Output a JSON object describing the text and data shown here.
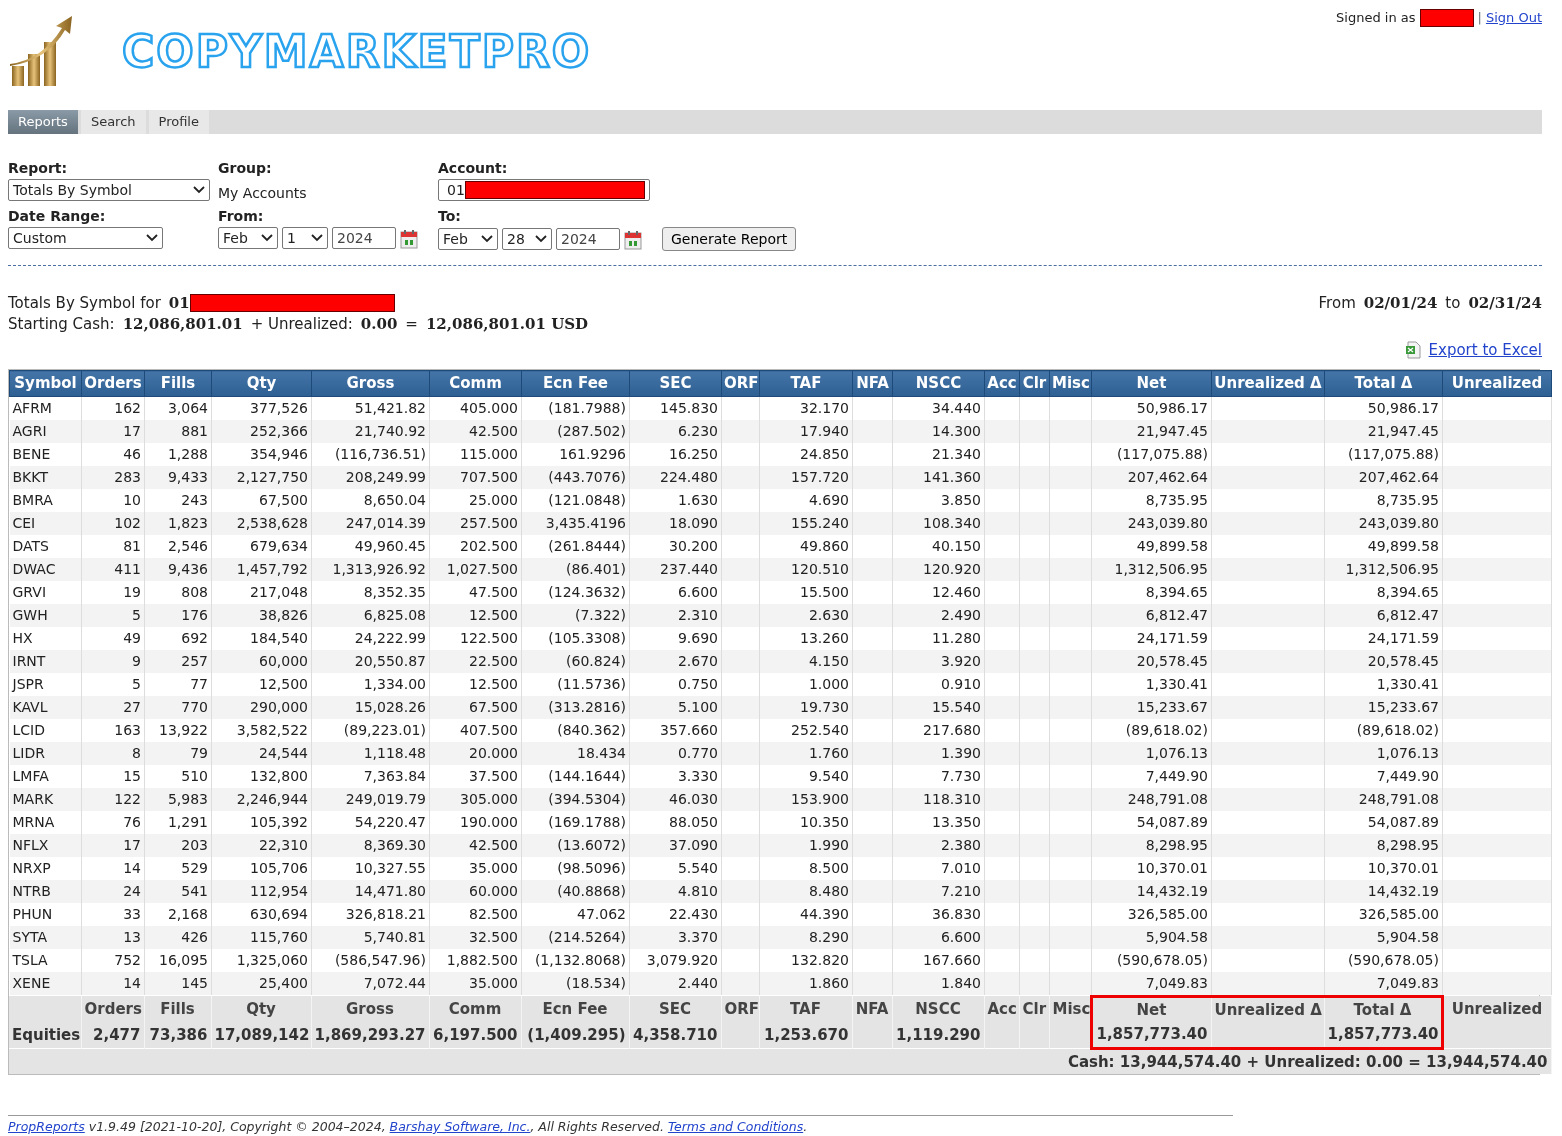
{
  "header": {
    "logo_text": "COPYMARKETPRO",
    "signed_in_label": "Signed in as",
    "user_redacted": true,
    "separator": "|",
    "sign_out": "Sign Out"
  },
  "tabs": [
    {
      "label": "Reports",
      "selected": true
    },
    {
      "label": "Search",
      "selected": false
    },
    {
      "label": "Profile",
      "selected": false
    }
  ],
  "form": {
    "report_label": "Report:",
    "report_value": "Totals By Symbol",
    "group_label": "Group:",
    "group_value": "My Accounts",
    "account_label": "Account:",
    "account_value": "01",
    "account_redacted": true,
    "date_range_label": "Date Range:",
    "date_range_value": "Custom",
    "from_label": "From:",
    "from_month": "Feb",
    "from_day": "1",
    "from_year": "2024",
    "to_label": "To:",
    "to_month": "Feb",
    "to_day": "28",
    "to_year": "2024",
    "generate_button": "Generate Report"
  },
  "summary": {
    "title": "Totals By Symbol for",
    "account": "01",
    "account_redacted": true,
    "starting_cash_label": "Starting Cash:",
    "starting_cash": "12,086,801.01",
    "plus_unrealized_label": "+ Unrealized:",
    "unrealized": "0.00",
    "equals": "=",
    "total": "12,086,801.01 USD",
    "from_label": "From",
    "from_date": "02/01/24",
    "to_label": "to",
    "to_date": "02/31/24",
    "export_link": "Export to Excel"
  },
  "table": {
    "columns": [
      "Symbol",
      "Orders",
      "Fills",
      "Qty",
      "Gross",
      "Comm",
      "Ecn Fee",
      "SEC",
      "ORF",
      "TAF",
      "NFA",
      "NSCC",
      "Acc",
      "Clr",
      "Misc",
      "Net",
      "Unrealized Δ",
      "Total Δ",
      "Unrealized"
    ],
    "rows": [
      [
        "AFRM",
        "162",
        "3,064",
        "377,526",
        "51,421.82",
        "405.000",
        "(181.7988)",
        "145.830",
        "",
        "32.170",
        "",
        "34.440",
        "",
        "",
        "",
        "50,986.17",
        "",
        "50,986.17",
        ""
      ],
      [
        "AGRI",
        "17",
        "881",
        "252,366",
        "21,740.92",
        "42.500",
        "(287.502)",
        "6.230",
        "",
        "17.940",
        "",
        "14.300",
        "",
        "",
        "",
        "21,947.45",
        "",
        "21,947.45",
        ""
      ],
      [
        "BENE",
        "46",
        "1,288",
        "354,946",
        "(116,736.51)",
        "115.000",
        "161.9296",
        "16.250",
        "",
        "24.850",
        "",
        "21.340",
        "",
        "",
        "",
        "(117,075.88)",
        "",
        "(117,075.88)",
        ""
      ],
      [
        "BKKT",
        "283",
        "9,433",
        "2,127,750",
        "208,249.99",
        "707.500",
        "(443.7076)",
        "224.480",
        "",
        "157.720",
        "",
        "141.360",
        "",
        "",
        "",
        "207,462.64",
        "",
        "207,462.64",
        ""
      ],
      [
        "BMRA",
        "10",
        "243",
        "67,500",
        "8,650.04",
        "25.000",
        "(121.0848)",
        "1.630",
        "",
        "4.690",
        "",
        "3.850",
        "",
        "",
        "",
        "8,735.95",
        "",
        "8,735.95",
        ""
      ],
      [
        "CEI",
        "102",
        "1,823",
        "2,538,628",
        "247,014.39",
        "257.500",
        "3,435.4196",
        "18.090",
        "",
        "155.240",
        "",
        "108.340",
        "",
        "",
        "",
        "243,039.80",
        "",
        "243,039.80",
        ""
      ],
      [
        "DATS",
        "81",
        "2,546",
        "679,634",
        "49,960.45",
        "202.500",
        "(261.8444)",
        "30.200",
        "",
        "49.860",
        "",
        "40.150",
        "",
        "",
        "",
        "49,899.58",
        "",
        "49,899.58",
        ""
      ],
      [
        "DWAC",
        "411",
        "9,436",
        "1,457,792",
        "1,313,926.92",
        "1,027.500",
        "(86.401)",
        "237.440",
        "",
        "120.510",
        "",
        "120.920",
        "",
        "",
        "",
        "1,312,506.95",
        "",
        "1,312,506.95",
        ""
      ],
      [
        "GRVI",
        "19",
        "808",
        "217,048",
        "8,352.35",
        "47.500",
        "(124.3632)",
        "6.600",
        "",
        "15.500",
        "",
        "12.460",
        "",
        "",
        "",
        "8,394.65",
        "",
        "8,394.65",
        ""
      ],
      [
        "GWH",
        "5",
        "176",
        "38,826",
        "6,825.08",
        "12.500",
        "(7.322)",
        "2.310",
        "",
        "2.630",
        "",
        "2.490",
        "",
        "",
        "",
        "6,812.47",
        "",
        "6,812.47",
        ""
      ],
      [
        "HX",
        "49",
        "692",
        "184,540",
        "24,222.99",
        "122.500",
        "(105.3308)",
        "9.690",
        "",
        "13.260",
        "",
        "11.280",
        "",
        "",
        "",
        "24,171.59",
        "",
        "24,171.59",
        ""
      ],
      [
        "IRNT",
        "9",
        "257",
        "60,000",
        "20,550.87",
        "22.500",
        "(60.824)",
        "2.670",
        "",
        "4.150",
        "",
        "3.920",
        "",
        "",
        "",
        "20,578.45",
        "",
        "20,578.45",
        ""
      ],
      [
        "JSPR",
        "5",
        "77",
        "12,500",
        "1,334.00",
        "12.500",
        "(11.5736)",
        "0.750",
        "",
        "1.000",
        "",
        "0.910",
        "",
        "",
        "",
        "1,330.41",
        "",
        "1,330.41",
        ""
      ],
      [
        "KAVL",
        "27",
        "770",
        "290,000",
        "15,028.26",
        "67.500",
        "(313.2816)",
        "5.100",
        "",
        "19.730",
        "",
        "15.540",
        "",
        "",
        "",
        "15,233.67",
        "",
        "15,233.67",
        ""
      ],
      [
        "LCID",
        "163",
        "13,922",
        "3,582,522",
        "(89,223.01)",
        "407.500",
        "(840.362)",
        "357.660",
        "",
        "252.540",
        "",
        "217.680",
        "",
        "",
        "",
        "(89,618.02)",
        "",
        "(89,618.02)",
        ""
      ],
      [
        "LIDR",
        "8",
        "79",
        "24,544",
        "1,118.48",
        "20.000",
        "18.434",
        "0.770",
        "",
        "1.760",
        "",
        "1.390",
        "",
        "",
        "",
        "1,076.13",
        "",
        "1,076.13",
        ""
      ],
      [
        "LMFA",
        "15",
        "510",
        "132,800",
        "7,363.84",
        "37.500",
        "(144.1644)",
        "3.330",
        "",
        "9.540",
        "",
        "7.730",
        "",
        "",
        "",
        "7,449.90",
        "",
        "7,449.90",
        ""
      ],
      [
        "MARK",
        "122",
        "5,983",
        "2,246,944",
        "249,019.79",
        "305.000",
        "(394.5304)",
        "46.030",
        "",
        "153.900",
        "",
        "118.310",
        "",
        "",
        "",
        "248,791.08",
        "",
        "248,791.08",
        ""
      ],
      [
        "MRNA",
        "76",
        "1,291",
        "105,392",
        "54,220.47",
        "190.000",
        "(169.1788)",
        "88.050",
        "",
        "10.350",
        "",
        "13.350",
        "",
        "",
        "",
        "54,087.89",
        "",
        "54,087.89",
        ""
      ],
      [
        "NFLX",
        "17",
        "203",
        "22,310",
        "8,369.30",
        "42.500",
        "(13.6072)",
        "37.090",
        "",
        "1.990",
        "",
        "2.380",
        "",
        "",
        "",
        "8,298.95",
        "",
        "8,298.95",
        ""
      ],
      [
        "NRXP",
        "14",
        "529",
        "105,706",
        "10,327.55",
        "35.000",
        "(98.5096)",
        "5.540",
        "",
        "8.500",
        "",
        "7.010",
        "",
        "",
        "",
        "10,370.01",
        "",
        "10,370.01",
        ""
      ],
      [
        "NTRB",
        "24",
        "541",
        "112,954",
        "14,471.80",
        "60.000",
        "(40.8868)",
        "4.810",
        "",
        "8.480",
        "",
        "7.210",
        "",
        "",
        "",
        "14,432.19",
        "",
        "14,432.19",
        ""
      ],
      [
        "PHUN",
        "33",
        "2,168",
        "630,694",
        "326,818.21",
        "82.500",
        "47.062",
        "22.430",
        "",
        "44.390",
        "",
        "36.830",
        "",
        "",
        "",
        "326,585.00",
        "",
        "326,585.00",
        ""
      ],
      [
        "SYTA",
        "13",
        "426",
        "115,760",
        "5,740.81",
        "32.500",
        "(214.5264)",
        "3.370",
        "",
        "8.290",
        "",
        "6.600",
        "",
        "",
        "",
        "5,904.58",
        "",
        "5,904.58",
        ""
      ],
      [
        "TSLA",
        "752",
        "16,095",
        "1,325,060",
        "(586,547.96)",
        "1,882.500",
        "(1,132.8068)",
        "3,079.920",
        "",
        "132.820",
        "",
        "167.660",
        "",
        "",
        "",
        "(590,678.05)",
        "",
        "(590,678.05)",
        ""
      ],
      [
        "XENE",
        "14",
        "145",
        "25,400",
        "7,072.44",
        "35.000",
        "(18.534)",
        "2.440",
        "",
        "1.860",
        "",
        "1.840",
        "",
        "",
        "",
        "7,049.83",
        "",
        "7,049.83",
        ""
      ]
    ]
  },
  "totals": {
    "columns": [
      {
        "label": "Orders",
        "value": "2,477",
        "highlighted": false
      },
      {
        "label": "Fills",
        "value": "73,386",
        "highlighted": false
      },
      {
        "label": "Qty",
        "value": "17,089,142",
        "highlighted": false
      },
      {
        "label": "Gross",
        "value": "1,869,293.27",
        "highlighted": false
      },
      {
        "label": "Comm",
        "value": "6,197.500",
        "highlighted": false
      },
      {
        "label": "Ecn Fee",
        "value": "(1,409.295)",
        "highlighted": false
      },
      {
        "label": "SEC",
        "value": "4,358.710",
        "highlighted": false
      },
      {
        "label": "ORF",
        "highlighted": false
      },
      {
        "label": "TAF",
        "value": "1,253.670",
        "highlighted": false
      },
      {
        "label": "NFA",
        "highlighted": false
      },
      {
        "label": "NSCC",
        "value": "1,119.290",
        "highlighted": false
      },
      {
        "label": "Acc",
        "highlighted": false
      },
      {
        "label": "Clr",
        "highlighted": false
      },
      {
        "label": "Misc",
        "highlighted": false
      },
      {
        "label": "Net",
        "value": "1,857,773.40",
        "highlighted": true
      },
      {
        "label": "Unrealized Δ",
        "highlighted": true
      },
      {
        "label": "Total Δ",
        "value": "1,857,773.40",
        "highlighted": true
      },
      {
        "label": "Unrealized",
        "highlighted": false
      }
    ],
    "row_label": "Equities",
    "cash_line": "Cash: 13,944,574.40 + Unrealized: 0.00 = 13,944,574.40"
  },
  "footer": [
    {
      "kind": "link",
      "text": "PropReports"
    },
    {
      "kind": "text",
      "text": " v1.9.49 [2021-10-20], Copyright © 2004–2024, "
    },
    {
      "kind": "link",
      "text": "Barshay Software, Inc."
    },
    {
      "kind": "text",
      "text": ", All Rights Reserved. "
    },
    {
      "kind": "link",
      "text": "Terms and Conditions"
    },
    {
      "kind": "text",
      "text": "."
    }
  ]
}
